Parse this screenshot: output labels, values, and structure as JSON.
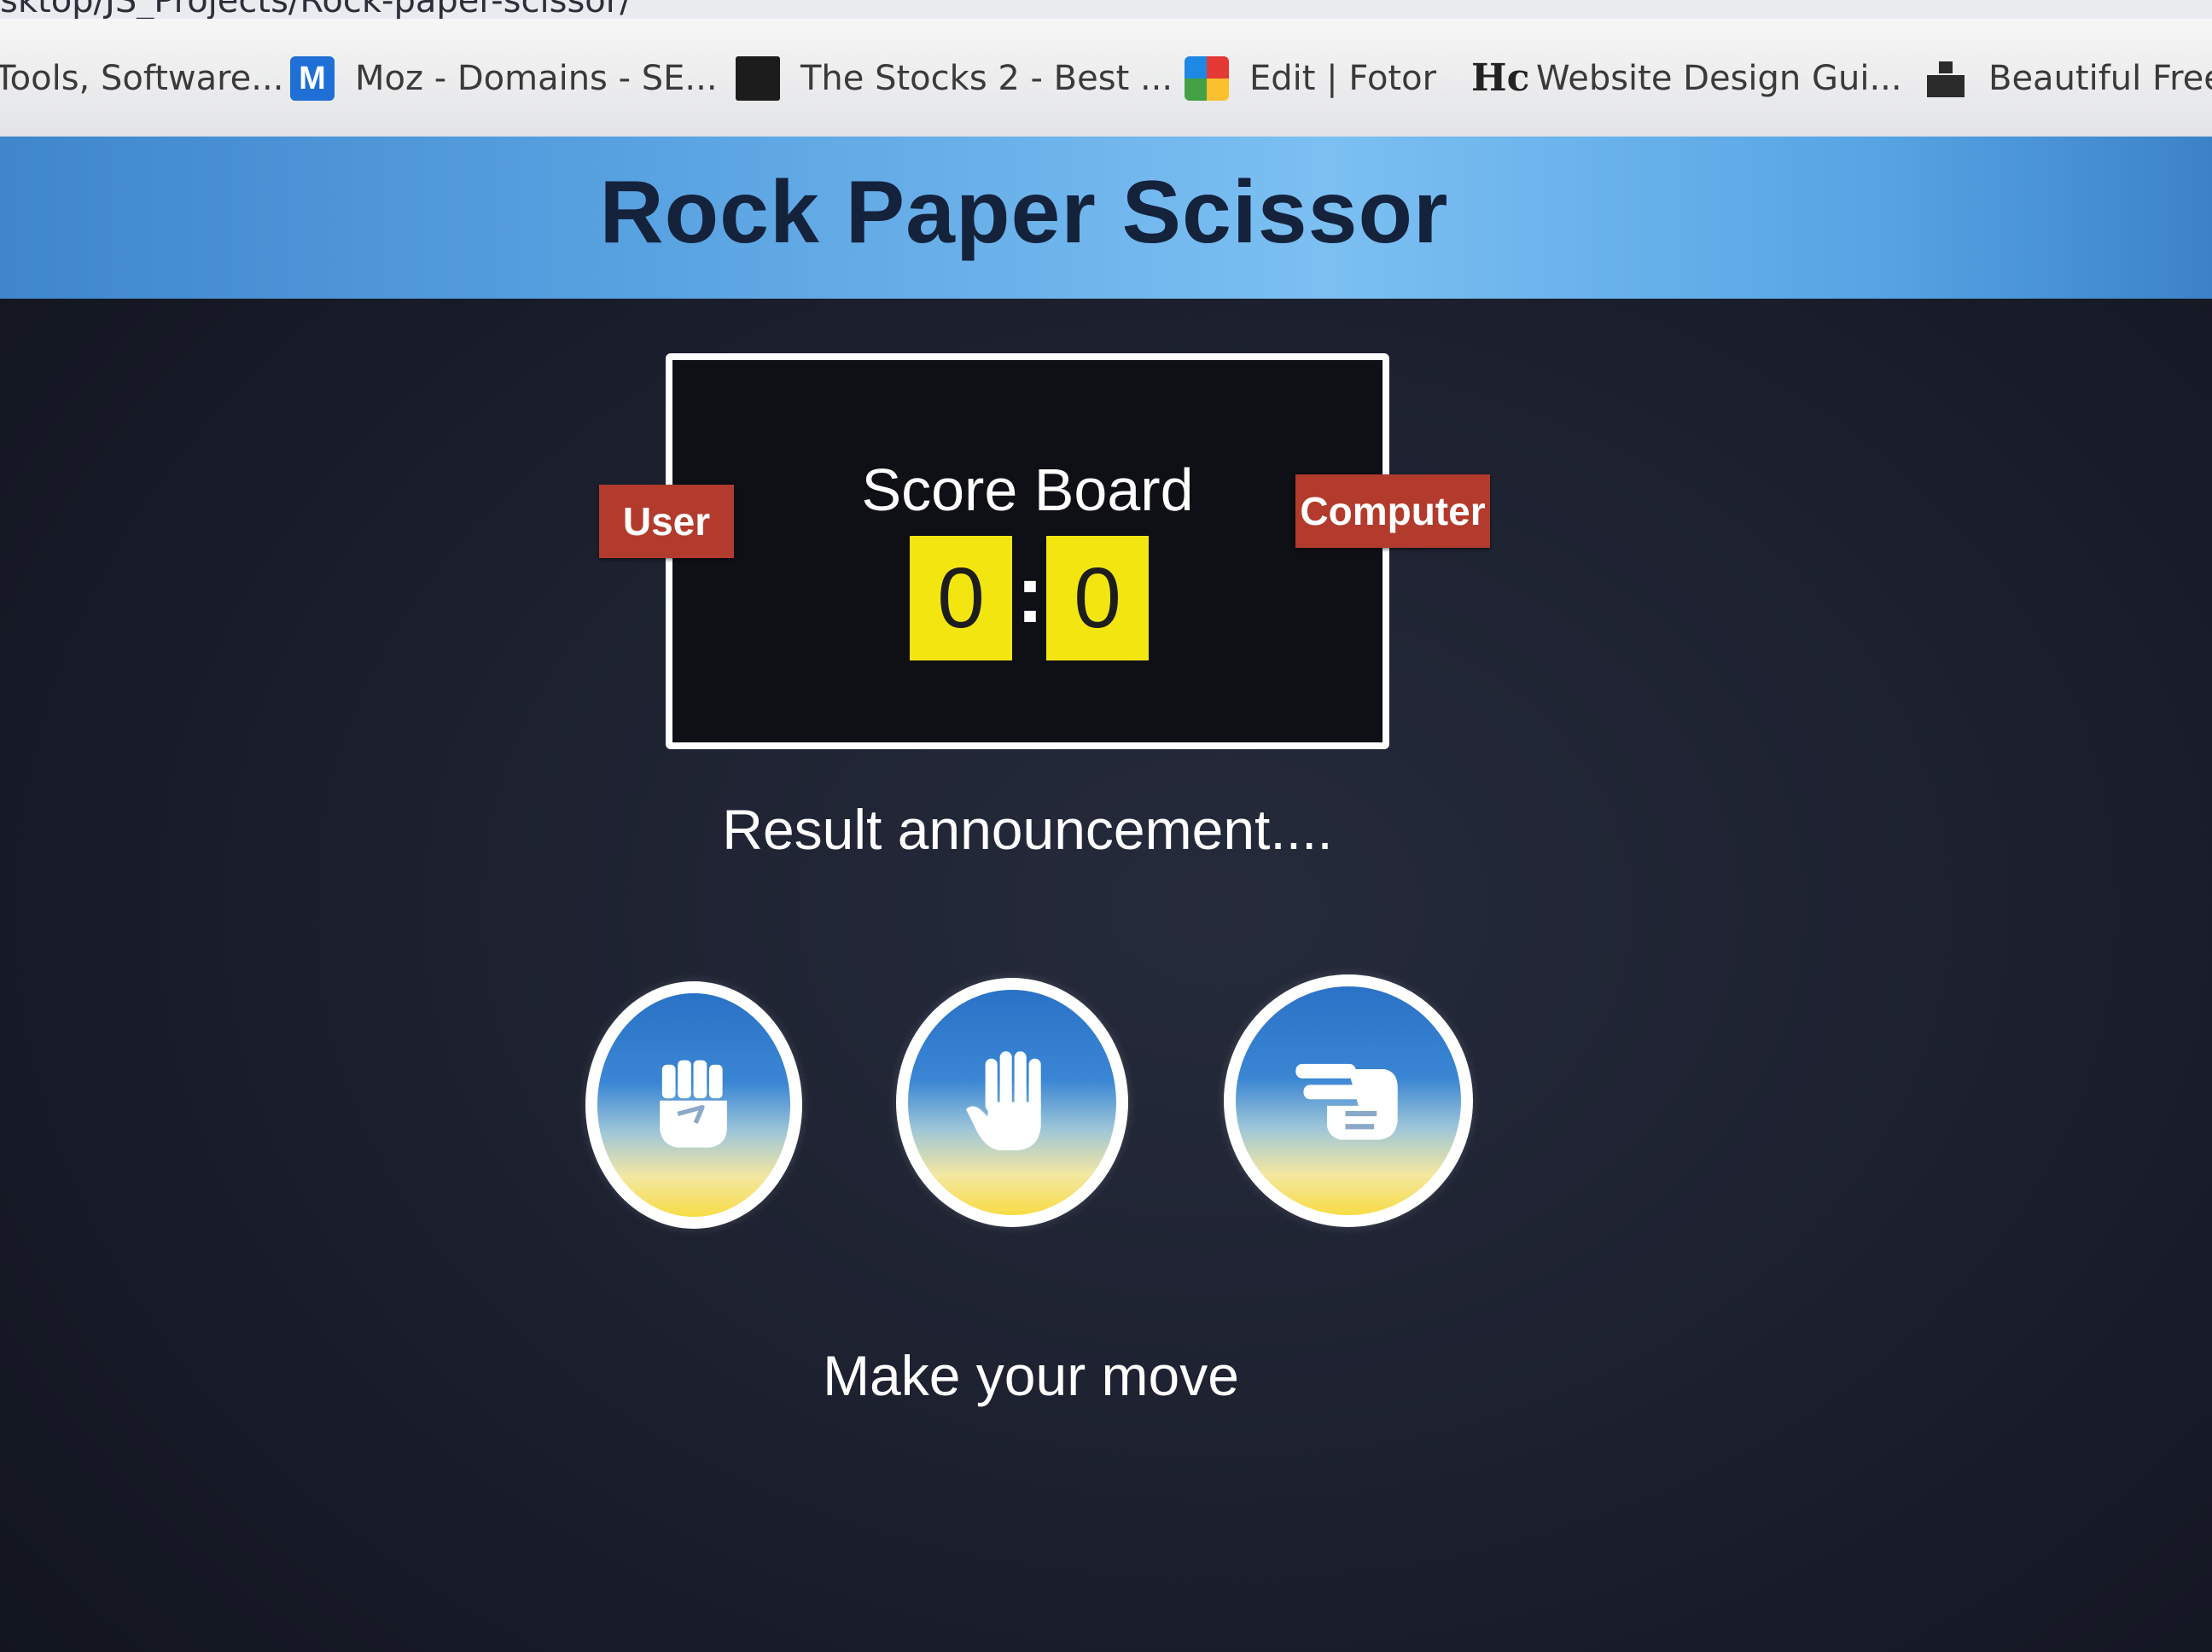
{
  "browser": {
    "url_fragment": "sktop/JS_Projects/Rock-paper-scissor/",
    "bookmarks": [
      {
        "label": "Tools, Software...",
        "icon": "none"
      },
      {
        "label": "Moz - Domains - SE...",
        "icon": "moz-icon"
      },
      {
        "label": "The Stocks 2 - Best ...",
        "icon": "stocks-icon"
      },
      {
        "label": "Edit | Fotor",
        "icon": "fotor-icon"
      },
      {
        "label": "Website Design Gui...",
        "icon": "hc-icon"
      },
      {
        "label": "Beautiful Free",
        "icon": "beautiful-icon"
      }
    ]
  },
  "app": {
    "title": "Rock Paper Scissor",
    "scoreboard": {
      "title": "Score Board",
      "user_label": "User",
      "computer_label": "Computer",
      "user_score": "0",
      "separator": ":",
      "computer_score": "0"
    },
    "result_text": "Result announcement....",
    "choices": [
      {
        "name": "rock",
        "icon": "fist-icon"
      },
      {
        "name": "paper",
        "icon": "open-hand-icon"
      },
      {
        "name": "scissor",
        "icon": "scissors-hand-icon"
      }
    ],
    "prompt": "Make your move"
  },
  "colors": {
    "header_gradient": "#5aa3e2",
    "title_text": "#15223c",
    "badge": "#b23b2d",
    "score_bg": "#f3e610",
    "page_bg": "#1a1e2c"
  }
}
